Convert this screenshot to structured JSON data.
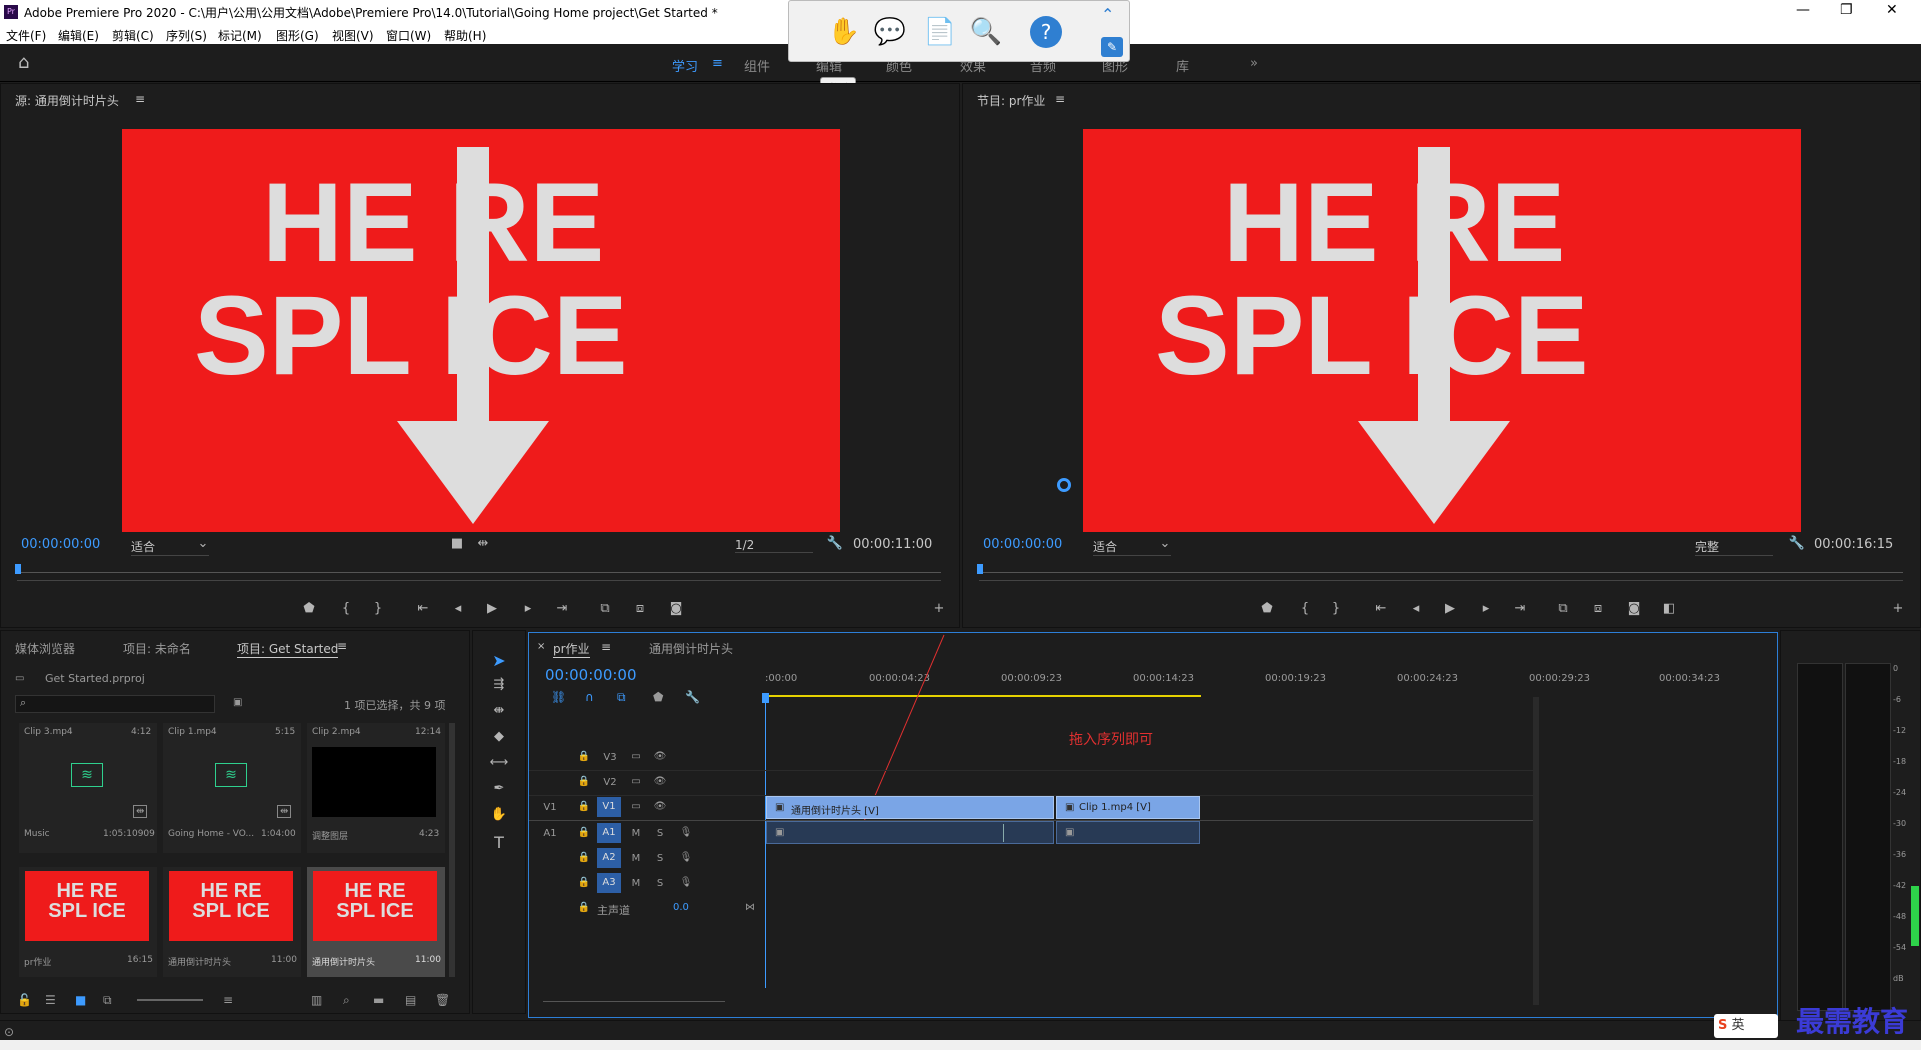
{
  "window": {
    "title": "Adobe Premiere Pro 2020 - C:\\用户\\公用\\公用文档\\Adobe\\Premiere Pro\\14.0\\Tutorial\\Going Home project\\Get Started *",
    "app_icon": "Pr"
  },
  "menu": [
    "文件(F)",
    "编辑(E)",
    "剪辑(C)",
    "序列(S)",
    "标记(M)",
    "图形(G)",
    "视图(V)",
    "窗口(W)",
    "帮助(H)"
  ],
  "workspaces": [
    "学习",
    "组件",
    "编辑",
    "颜色",
    "效果",
    "音频",
    "图形",
    "库"
  ],
  "overlay_toolbar": {
    "tooltip": "举手"
  },
  "source": {
    "title": "源: 通用倒计时片头",
    "timecode": "00:00:00:00",
    "fit": "适合",
    "resolution": "1/2",
    "duration": "00:00:11:00"
  },
  "program": {
    "title": "节目: pr作业",
    "timecode": "00:00:00:00",
    "fit": "适合",
    "quality": "完整",
    "duration": "00:00:16:15"
  },
  "frame_text": {
    "line1": "HE  RE",
    "line2": "SPL ICE"
  },
  "project": {
    "tabs": [
      "媒体浏览器",
      "项目: 未命名",
      "项目: Get Started"
    ],
    "file": "Get Started.prproj",
    "selection": "1 项已选择，共 9 项",
    "items": [
      {
        "name": "Clip 3.mp4",
        "dur": "4:12",
        "label": "Music",
        "sub": "1:05:10909",
        "kind": "audio"
      },
      {
        "name": "Clip 1.mp4",
        "dur": "5:15",
        "label": "Going Home - VO...",
        "sub": "1:04:00",
        "kind": "audio"
      },
      {
        "name": "Clip 2.mp4",
        "dur": "12:14",
        "label": "调整图层",
        "sub": "4:23",
        "kind": "black"
      },
      {
        "name": "",
        "dur": "",
        "label": "pr作业",
        "sub": "16:15",
        "kind": "splice"
      },
      {
        "name": "",
        "dur": "",
        "label": "通用倒计时片头",
        "sub": "11:00",
        "kind": "splice"
      },
      {
        "name": "",
        "dur": "",
        "label": "通用倒计时片头",
        "sub": "11:00",
        "kind": "splice"
      }
    ]
  },
  "timeline": {
    "tabs": [
      "pr作业",
      "通用倒计时片头"
    ],
    "timecode": "00:00:00:00",
    "ruler": [
      ":00:00",
      "00:00:04:23",
      "00:00:09:23",
      "00:00:14:23",
      "00:00:19:23",
      "00:00:24:23",
      "00:00:29:23",
      "00:00:34:23"
    ],
    "annotation": "拖入序列即可",
    "video_tracks": [
      "V3",
      "V2",
      "V1"
    ],
    "audio_tracks": [
      "A1",
      "A2",
      "A3"
    ],
    "master": "主声道",
    "master_val": "0.0",
    "clips": [
      {
        "label": "通用倒计时片头 [V]"
      },
      {
        "label": "Clip 1.mp4 [V]"
      }
    ]
  },
  "meter": [
    "0",
    "-6",
    "-12",
    "-18",
    "-24",
    "-30",
    "-36",
    "-42",
    "-48",
    "-54",
    "dB"
  ],
  "watermark": "最需教育",
  "ime": "英"
}
